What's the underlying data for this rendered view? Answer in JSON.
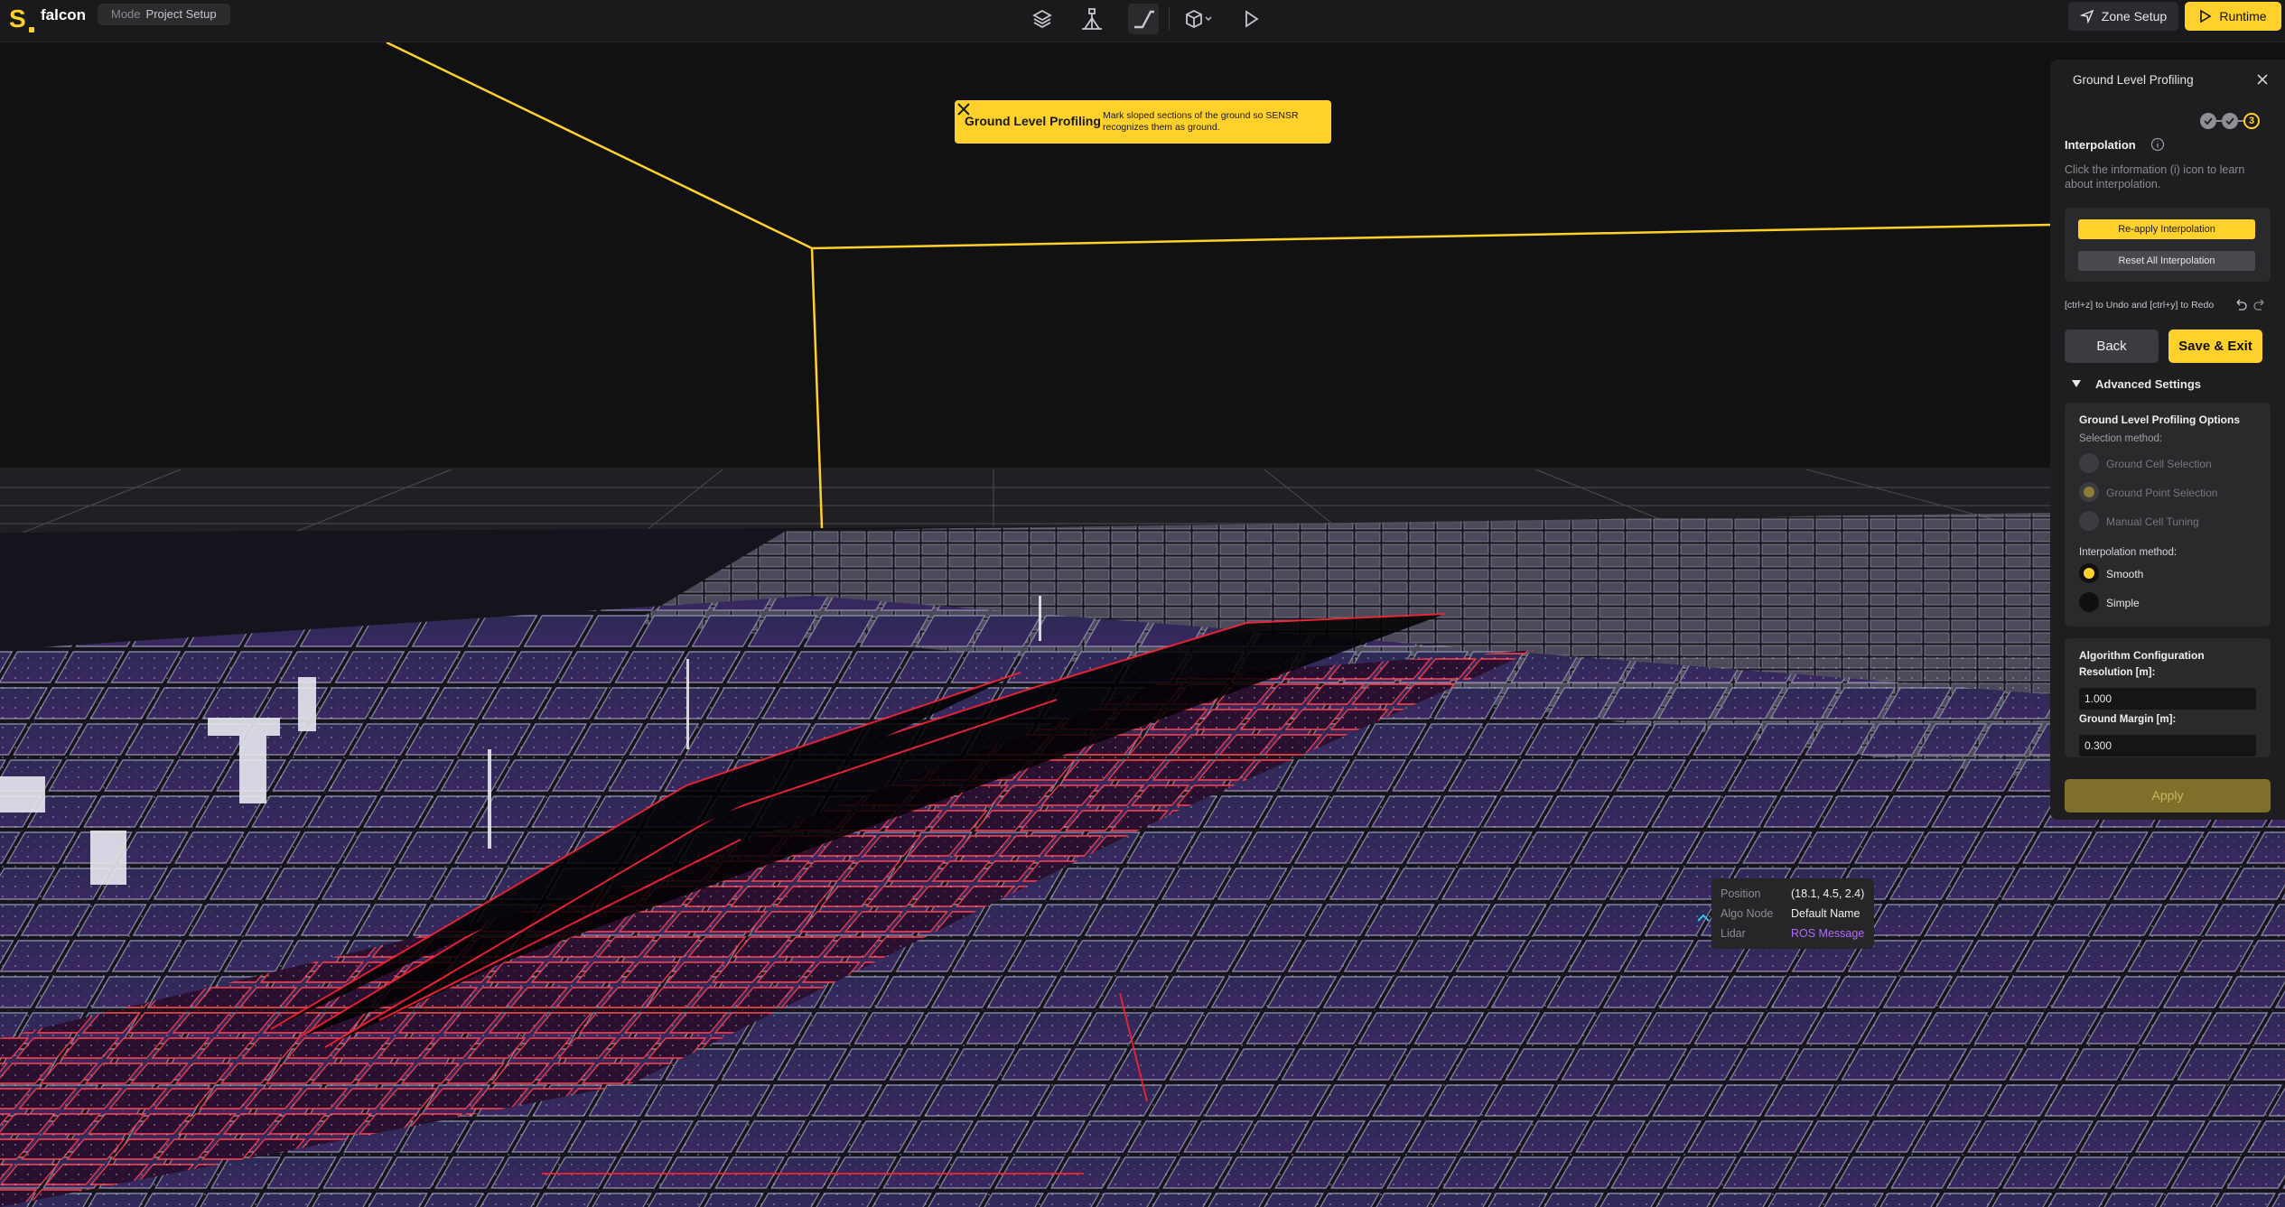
{
  "app": {
    "name": "falcon",
    "mode_label": "Mode",
    "mode_value": "Project Setup",
    "accent": "#ffd12a"
  },
  "toolbar": {
    "tools": [
      "layers-icon",
      "lidar-setup-icon",
      "ground-profile-icon",
      "cube-view-icon",
      "play-icon"
    ],
    "zone_setup_label": "Zone Setup",
    "runtime_label": "Runtime"
  },
  "toast": {
    "title": "Ground Level Profiling",
    "message": "Mark sloped sections of the ground so SENSR recognizes them as ground."
  },
  "tooltip": {
    "rows": [
      {
        "key": "Position",
        "value": "(18.1, 4.5, 2.4)"
      },
      {
        "key": "Algo Node",
        "value": "Default Name"
      },
      {
        "key": "Lidar",
        "value": "ROS Message"
      }
    ]
  },
  "panel": {
    "title": "Ground Level Profiling",
    "steps": [
      "done",
      "done",
      "3"
    ],
    "section_title": "Interpolation",
    "section_desc": "Click the information (i) icon to learn about interpolation.",
    "reapply_label": "Re-apply Interpolation",
    "reset_label": "Reset All Interpolation",
    "undo_hint": "[ctrl+z] to Undo and [ctrl+y] to Redo",
    "back_label": "Back",
    "save_label": "Save & Exit",
    "advanced_label": "Advanced Settings",
    "options": {
      "title": "Ground Level Profiling Options",
      "selection_label": "Selection method:",
      "selection_methods": [
        "Ground Cell Selection",
        "Ground Point Selection",
        "Manual Cell Tuning"
      ],
      "interpolation_label": "Interpolation method:",
      "interpolation_methods": [
        "Smooth",
        "Simple"
      ],
      "interpolation_selected": "Smooth"
    },
    "algo": {
      "title": "Algorithm Configuration",
      "resolution_label": "Resolution [m]:",
      "resolution_value": "1.000",
      "margin_label": "Ground Margin [m]:",
      "margin_value": "0.300"
    },
    "apply_label": "Apply"
  }
}
